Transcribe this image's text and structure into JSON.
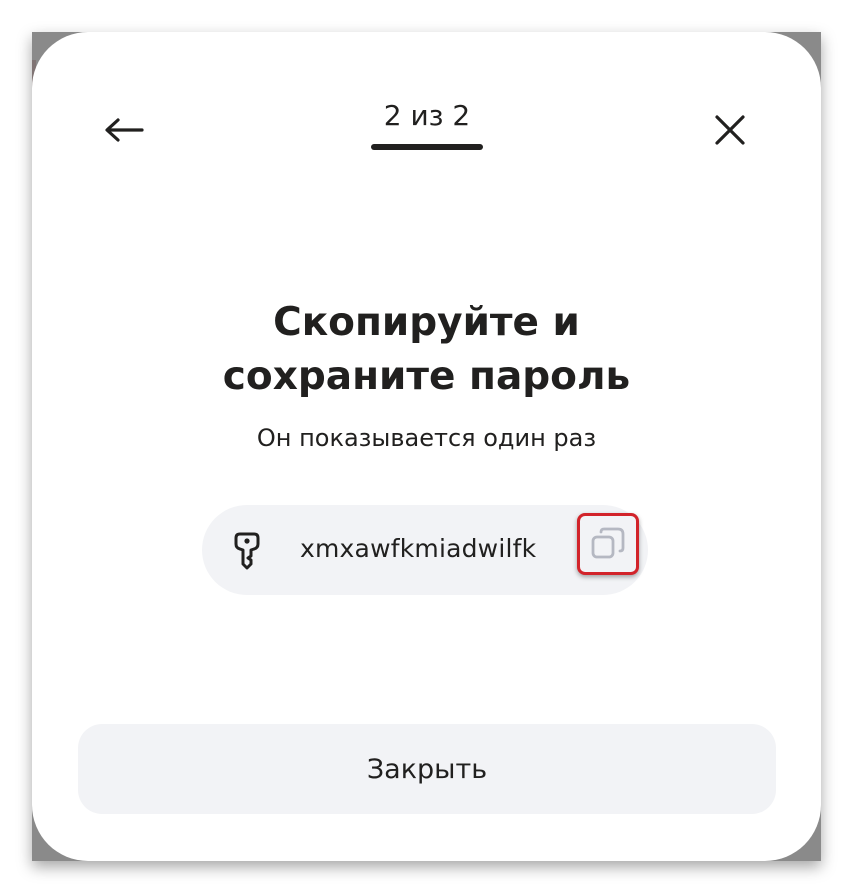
{
  "header": {
    "step_label": "2 из 2",
    "back_icon": "arrow-left-icon",
    "close_icon": "close-icon"
  },
  "content": {
    "title_line1": "Скопируйте и",
    "title_line2": "сохраните пароль",
    "subtitle": "Он показывается один раз"
  },
  "password": {
    "value": "xmxawfkmiadwilfk",
    "key_icon": "key-icon",
    "copy_icon": "copy-icon"
  },
  "footer": {
    "close_label": "Закрыть"
  },
  "colors": {
    "text": "#21201f",
    "field_bg": "#f2f3f6",
    "highlight": "#d2232a"
  }
}
